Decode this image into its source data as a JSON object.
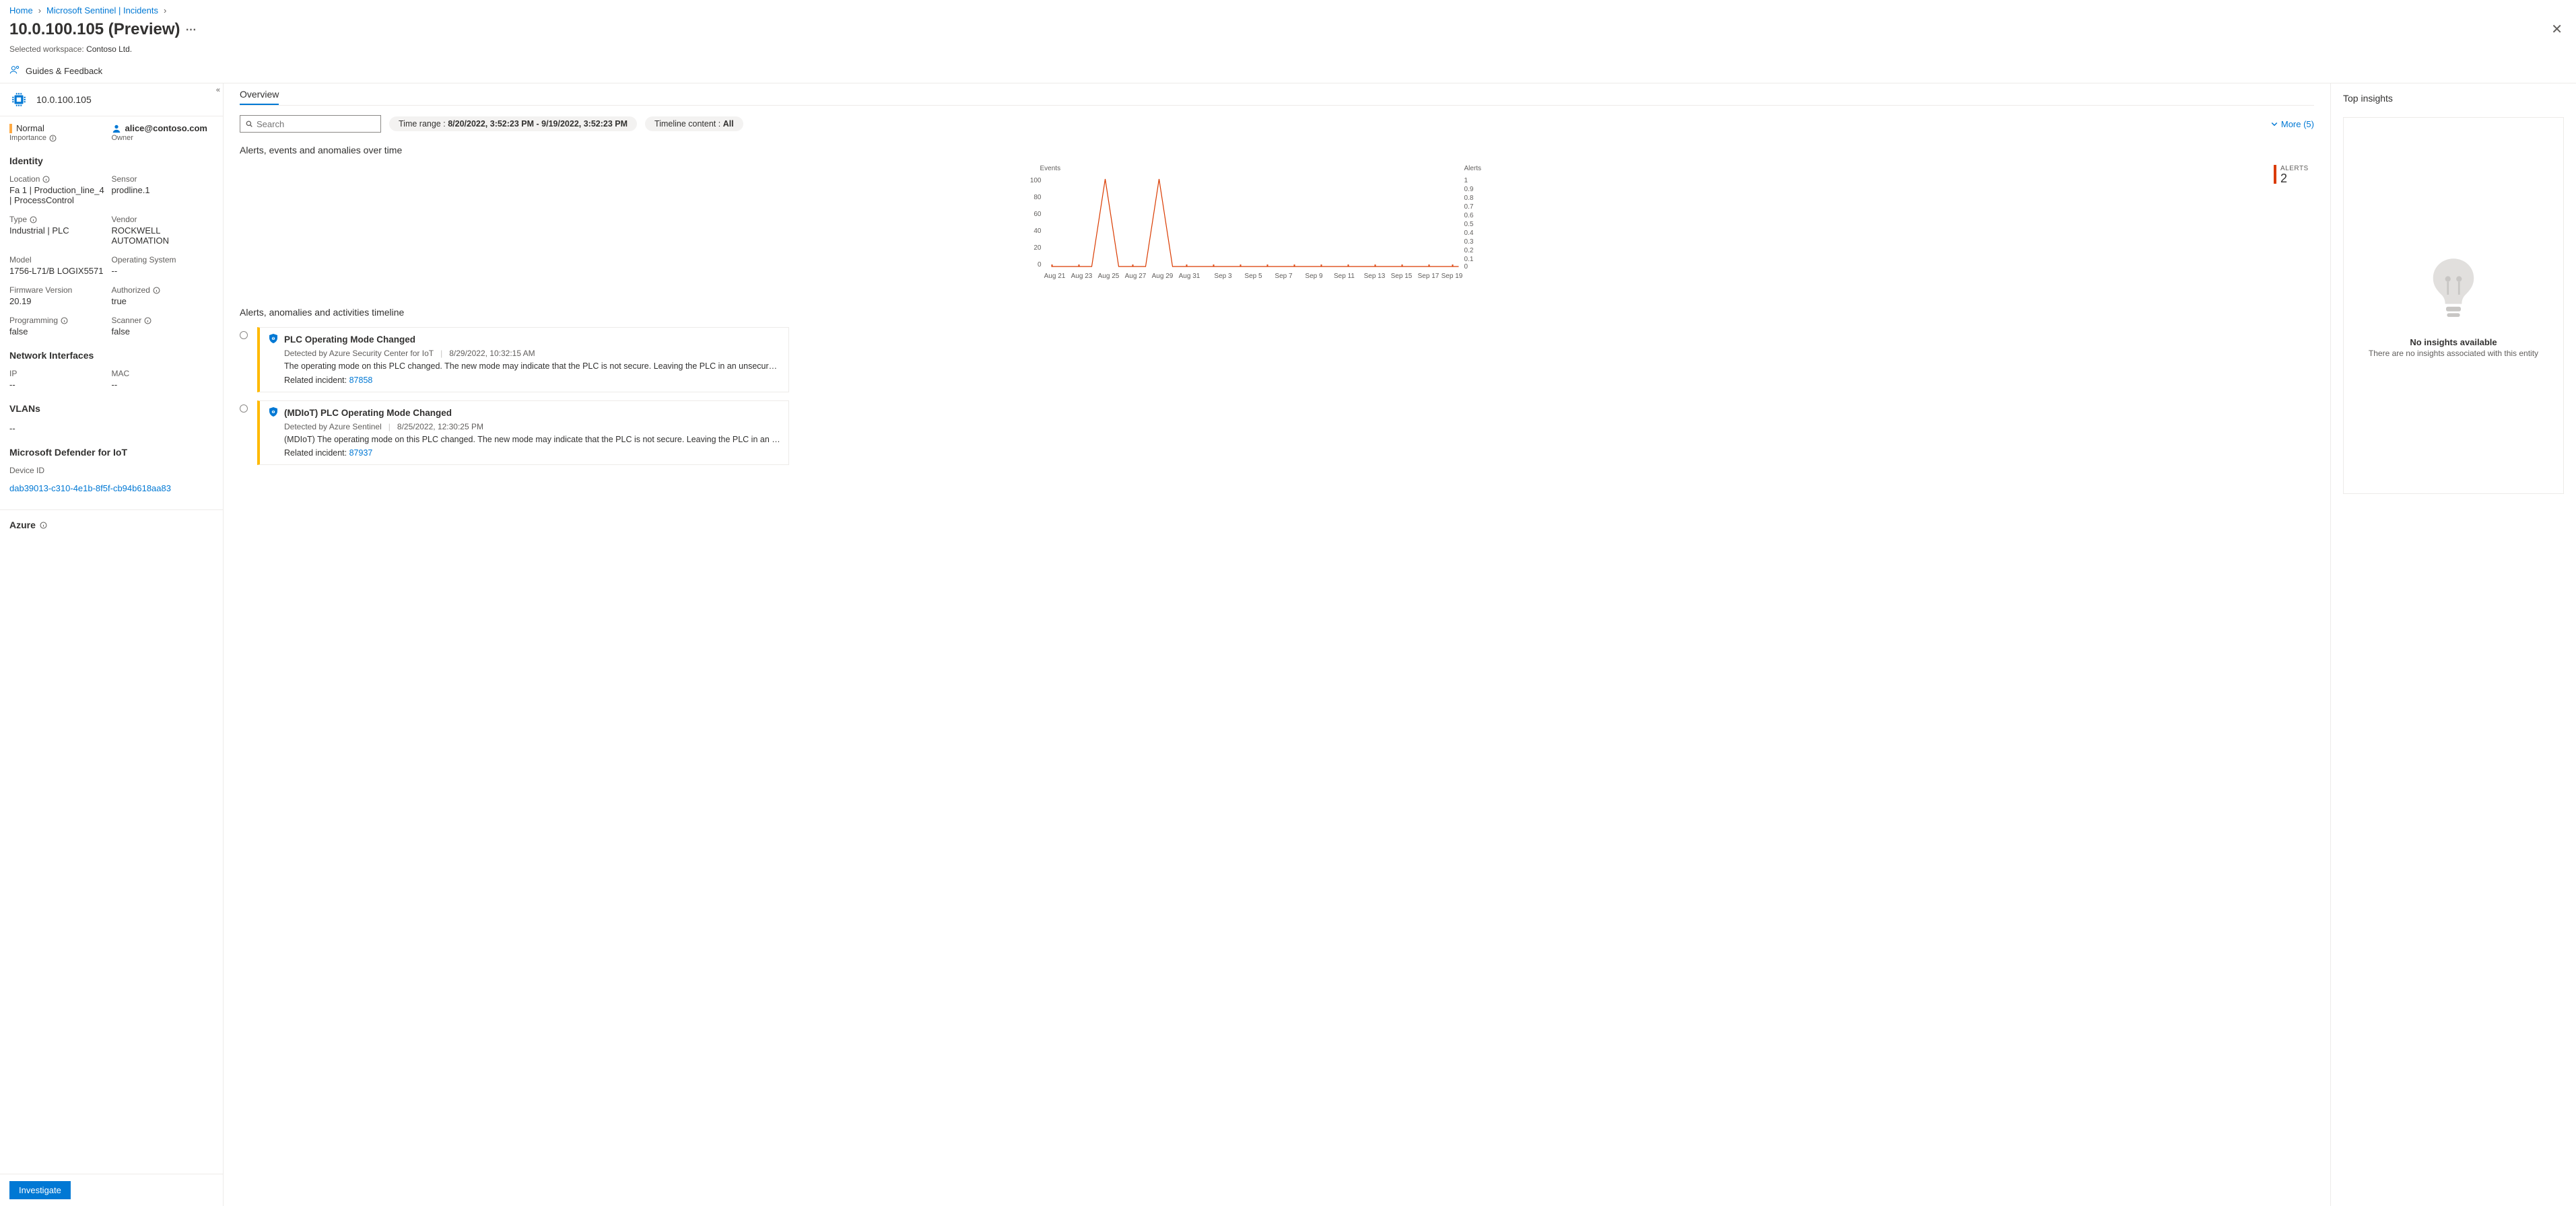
{
  "breadcrumb": {
    "home": "Home",
    "sentinel": "Microsoft Sentinel | Incidents"
  },
  "header": {
    "title": "10.0.100.105 (Preview)",
    "workspace_prefix": "Selected workspace:",
    "workspace": "Contoso Ltd.",
    "guides": "Guides & Feedback"
  },
  "sidebar": {
    "entity_name": "10.0.100.105",
    "status": "Normal",
    "status_label": "Importance",
    "owner": "alice@contoso.com",
    "owner_label": "Owner",
    "identity": {
      "title": "Identity",
      "location_label": "Location",
      "location": "Fa 1 | Production_line_4 | ProcessControl",
      "sensor_label": "Sensor",
      "sensor": "prodline.1",
      "type_label": "Type",
      "type": "Industrial | PLC",
      "vendor_label": "Vendor",
      "vendor": "ROCKWELL AUTOMATION",
      "model_label": "Model",
      "model": "1756-L71/B LOGIX5571",
      "os_label": "Operating System",
      "os": "--",
      "fw_label": "Firmware Version",
      "fw": "20.19",
      "auth_label": "Authorized",
      "auth": "true",
      "prog_label": "Programming",
      "prog": "false",
      "scan_label": "Scanner",
      "scan": "false"
    },
    "network": {
      "title": "Network Interfaces",
      "ip_label": "IP",
      "ip": "--",
      "mac_label": "MAC",
      "mac": "--"
    },
    "vlans": {
      "title": "VLANs",
      "val": "--"
    },
    "defender": {
      "title": "Microsoft Defender for IoT",
      "device_label": "Device ID",
      "device_id": "dab39013-c310-4e1b-8f5f-cb94b618aa83"
    },
    "azure": {
      "title": "Azure"
    },
    "investigate": "Investigate"
  },
  "main": {
    "tab_overview": "Overview",
    "search_placeholder": "Search",
    "timerange_label": "Time range :",
    "timerange": "8/20/2022, 3:52:23 PM - 9/19/2022, 3:52:23 PM",
    "timeline_content_label": "Timeline content :",
    "timeline_content": "All",
    "more": "More (5)",
    "chart_title": "Alerts, events and anomalies over time",
    "chart_events_label": "Events",
    "chart_alerts_label": "Alerts",
    "alerts_kpi_label": "ALERTS",
    "alerts_kpi_value": "2",
    "timeline_title": "Alerts, anomalies and activities timeline",
    "timeline": [
      {
        "title": "PLC Operating Mode Changed",
        "source": "Detected by Azure Security Center for IoT",
        "time": "8/29/2022, 10:32:15 AM",
        "desc": "The operating mode on this PLC changed. The new mode may indicate that the PLC is not secure. Leaving the PLC in an unsecure operating mode may allow …",
        "related_label": "Related incident:",
        "related_id": "87858"
      },
      {
        "title": "(MDIoT) PLC Operating Mode Changed",
        "source": "Detected by Azure Sentinel",
        "time": "8/25/2022, 12:30:25 PM",
        "desc": "(MDIoT) The operating mode on this PLC changed. The new mode may indicate that the PLC is not secure. Leaving the PLC in an unsecure operating mode m…",
        "related_label": "Related incident:",
        "related_id": "87937"
      }
    ]
  },
  "insights": {
    "title": "Top insights",
    "none": "No insights available",
    "sub": "There are no insights associated with this entity"
  },
  "chart_data": {
    "type": "line",
    "title": "Alerts, events and anomalies over time",
    "series": [
      {
        "name": "Events",
        "x": [
          "Aug 21",
          "Aug 23",
          "Aug 25",
          "Aug 27",
          "Aug 29",
          "Aug 31",
          "Sep 3",
          "Sep 5",
          "Sep 7",
          "Sep 9",
          "Sep 11",
          "Sep 13",
          "Sep 15",
          "Sep 17",
          "Sep 19"
        ],
        "values": [
          0,
          0,
          110,
          0,
          110,
          0,
          0,
          0,
          0,
          0,
          0,
          0,
          0,
          0,
          0
        ]
      },
      {
        "name": "Alerts",
        "x": [
          "Aug 21",
          "Aug 23",
          "Aug 25",
          "Aug 27",
          "Aug 29",
          "Aug 31",
          "Sep 3",
          "Sep 5",
          "Sep 7",
          "Sep 9",
          "Sep 11",
          "Sep 13",
          "Sep 15",
          "Sep 17",
          "Sep 19"
        ],
        "values": [
          0,
          0,
          1,
          0,
          1,
          0,
          0,
          0,
          0,
          0,
          0,
          0,
          0,
          0,
          0
        ]
      }
    ],
    "y_left": {
      "label": "Events",
      "ticks": [
        0,
        20,
        40,
        60,
        80,
        100
      ],
      "lim": [
        0,
        110
      ]
    },
    "y_right": {
      "label": "Alerts",
      "ticks": [
        0,
        0.1,
        0.2,
        0.3,
        0.4,
        0.5,
        0.6,
        0.7,
        0.8,
        0.9,
        1
      ],
      "lim": [
        0,
        1.05
      ]
    },
    "x_ticks": [
      "Aug 21",
      "Aug 23",
      "Aug 25",
      "Aug 27",
      "Aug 29",
      "Aug 31",
      "Sep 3",
      "Sep 5",
      "Sep 7",
      "Sep 9",
      "Sep 11",
      "Sep 13",
      "Sep 15",
      "Sep 17",
      "Sep 19"
    ]
  }
}
